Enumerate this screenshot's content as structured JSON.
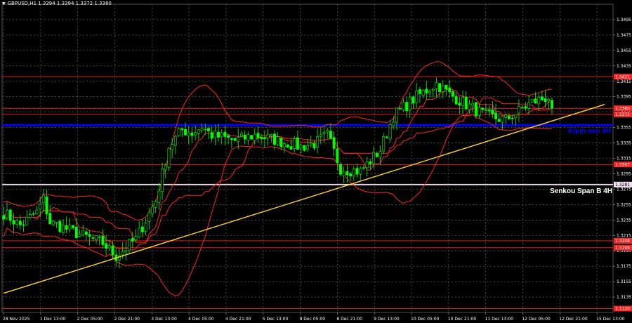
{
  "window": {
    "title": "GBPUSD,H1  1.3394 1.3394 1.3372 1.3380"
  },
  "colors": {
    "background": "#000000",
    "grid": "#6f6f6f",
    "axis_text": "#ffffff",
    "candle_up": "#00ff00",
    "candle_down": "#00ff00",
    "ichimoku": "#ff2222",
    "level_red": "#ff2222",
    "kijun_line": "#0000ff",
    "kijun_label": "#0000ff",
    "senkou_line": "#e8d0e8",
    "senkou_label": "#ffffff",
    "trendline": "#ffd42a"
  },
  "chart_data": {
    "type": "candlestick",
    "symbol": "GBPUSD",
    "timeframe": "H1",
    "ohlc_header": {
      "open": 1.3394,
      "high": 1.3394,
      "low": 1.3372,
      "close": 1.338
    },
    "y_ticks": [
      1.3495,
      1.3475,
      1.3455,
      1.3435,
      1.3415,
      1.3395,
      1.3375,
      1.3355,
      1.3335,
      1.3315,
      1.3295,
      1.3275,
      1.3255,
      1.3235,
      1.3215,
      1.3195,
      1.3175,
      1.3155,
      1.3135
    ],
    "ylim": [
      1.3115,
      1.3515
    ],
    "x_ticks": [
      "28 Nov 2025",
      "1 Dec 13:00",
      "2 Dec 05:00",
      "2 Dec 21:00",
      "3 Dec 13:00",
      "4 Dec 05:00",
      "4 Dec 21:00",
      "5 Dec 13:00",
      "8 Dec 05:00",
      "8 Dec 21:00",
      "9 Dec 13:00",
      "10 Dec 05:00",
      "10 Dec 21:00",
      "11 Dec 13:00",
      "12 Dec 05:00",
      "12 Dec 21:00",
      "15 Dec 13:00"
    ],
    "price_levels": [
      {
        "price": 1.3421,
        "label": "1.3421"
      },
      {
        "price": 1.338,
        "label": "1.3380"
      },
      {
        "price": 1.3372,
        "label": "1.3372"
      },
      {
        "price": 1.3307,
        "label": "1.3307"
      },
      {
        "price": 1.3281,
        "label": "1.3281"
      },
      {
        "price": 1.3208,
        "label": "1.3208"
      },
      {
        "price": 1.3199,
        "label": "1.3199"
      },
      {
        "price": 1.312,
        "label": "1.3120"
      }
    ],
    "indicator_lines": [
      {
        "name": "Kijun-sen 4H",
        "price": 1.3358
      },
      {
        "name": "Senkou Span B 4H",
        "price": 1.3281
      }
    ],
    "trendline": {
      "start": {
        "bar": 0,
        "price": 1.314
      },
      "end": {
        "bar": 182,
        "price": 1.3385
      }
    },
    "close_anchors": [
      [
        0,
        1.3244
      ],
      [
        5,
        1.3228
      ],
      [
        10,
        1.3245
      ],
      [
        12,
        1.3262
      ],
      [
        14,
        1.3232
      ],
      [
        22,
        1.3218
      ],
      [
        30,
        1.3205
      ],
      [
        34,
        1.3188
      ],
      [
        40,
        1.321
      ],
      [
        46,
        1.326
      ],
      [
        50,
        1.333
      ],
      [
        54,
        1.3352
      ],
      [
        57,
        1.3348
      ],
      [
        60,
        1.3356
      ],
      [
        63,
        1.3345
      ],
      [
        70,
        1.3338
      ],
      [
        76,
        1.3345
      ],
      [
        83,
        1.3338
      ],
      [
        90,
        1.333
      ],
      [
        94,
        1.3334
      ],
      [
        98,
        1.3345
      ],
      [
        102,
        1.3302
      ],
      [
        108,
        1.3298
      ],
      [
        114,
        1.3326
      ],
      [
        118,
        1.337
      ],
      [
        125,
        1.3395
      ],
      [
        131,
        1.3412
      ],
      [
        135,
        1.3398
      ],
      [
        140,
        1.3385
      ],
      [
        146,
        1.337
      ],
      [
        152,
        1.3365
      ],
      [
        160,
        1.3388
      ],
      [
        166,
        1.3396
      ]
    ]
  }
}
